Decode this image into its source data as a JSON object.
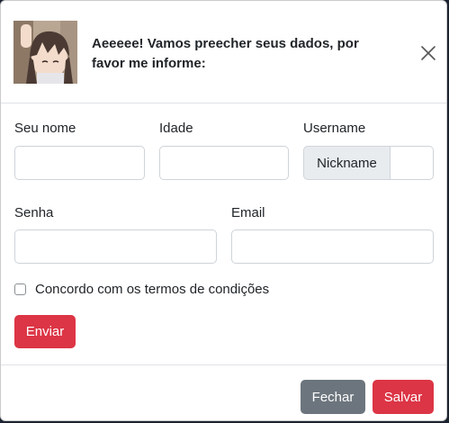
{
  "header": {
    "title": "Aeeeee! Vamos preecher seus dados, por favor me informe:",
    "avatar_icon": "anime-avatar-icon",
    "close_icon": "close-icon"
  },
  "form": {
    "name_label": "Seu nome",
    "age_label": "Idade",
    "username_label": "Username",
    "username_addon": "Nickname",
    "password_label": "Senha",
    "email_label": "Email",
    "terms_label": "Concordo com os termos de condições",
    "submit_label": "Enviar"
  },
  "footer": {
    "close_label": "Fechar",
    "save_label": "Salvar"
  },
  "colors": {
    "danger": "#dc3545",
    "secondary": "#6c757d",
    "addon_bg": "#e9ecef",
    "border": "#ced4da"
  }
}
